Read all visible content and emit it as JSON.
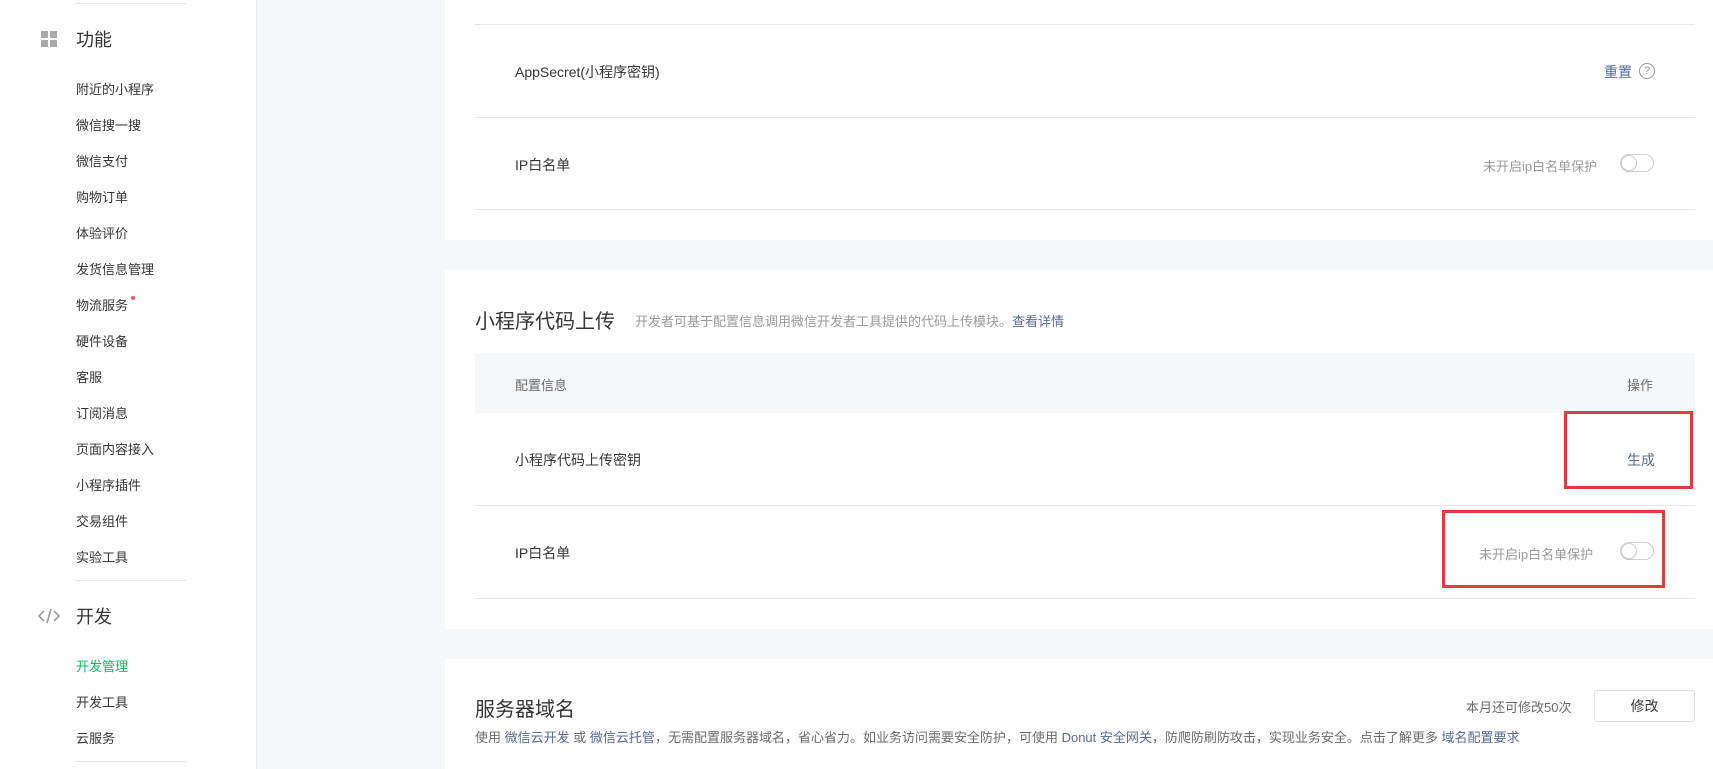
{
  "sidebar": {
    "sections": [
      {
        "label": "功能",
        "icon": "grid-icon",
        "items": [
          {
            "label": "附近的小程序"
          },
          {
            "label": "微信搜一搜"
          },
          {
            "label": "微信支付"
          },
          {
            "label": "购物订单"
          },
          {
            "label": "体验评价"
          },
          {
            "label": "发货信息管理"
          },
          {
            "label": "物流服务"
          },
          {
            "label": "硬件设备"
          },
          {
            "label": "客服"
          },
          {
            "label": "订阅消息"
          },
          {
            "label": "页面内容接入"
          },
          {
            "label": "小程序插件"
          },
          {
            "label": "交易组件"
          },
          {
            "label": "实验工具"
          }
        ]
      },
      {
        "label": "开发",
        "icon": "code-icon",
        "items": [
          {
            "label": "开发管理",
            "active": true
          },
          {
            "label": "开发工具"
          },
          {
            "label": "云服务"
          }
        ]
      }
    ]
  },
  "dev_config": {
    "appsecret_label": "AppSecret(小程序密钥)",
    "appsecret_action": "重置",
    "ip_label": "IP白名单",
    "ip_status": "未开启ip白名单保护"
  },
  "upload": {
    "title": "小程序代码上传",
    "desc": "开发者可基于配置信息调用微信开发者工具提供的代码上传模块。",
    "desc_link": "查看详情",
    "col_config": "配置信息",
    "col_action": "操作",
    "key_label": "小程序代码上传密钥",
    "key_action": "生成",
    "ip_label": "IP白名单",
    "ip_status": "未开启ip白名单保护"
  },
  "server": {
    "title": "服务器域名",
    "quota": "本月还可修改50次",
    "modify_button": "修改",
    "desc_use": "使用",
    "link_cloud_dev": "微信云开发",
    "desc_or": "或",
    "link_cloud_host": "微信云托管",
    "desc_mid": "，无需配置服务器域名，省心省力。如业务访问需要安全防护，可使用",
    "link_donut": "Donut 安全网关",
    "desc_end": "，防爬防刷防攻击，实现业务安全。点击了解更多",
    "link_domain": "域名配置要求"
  },
  "colors": {
    "accent_green": "#07c160",
    "link_blue": "#576b95",
    "highlight_red": "#e03c3c",
    "badge_red": "#fa5151"
  }
}
